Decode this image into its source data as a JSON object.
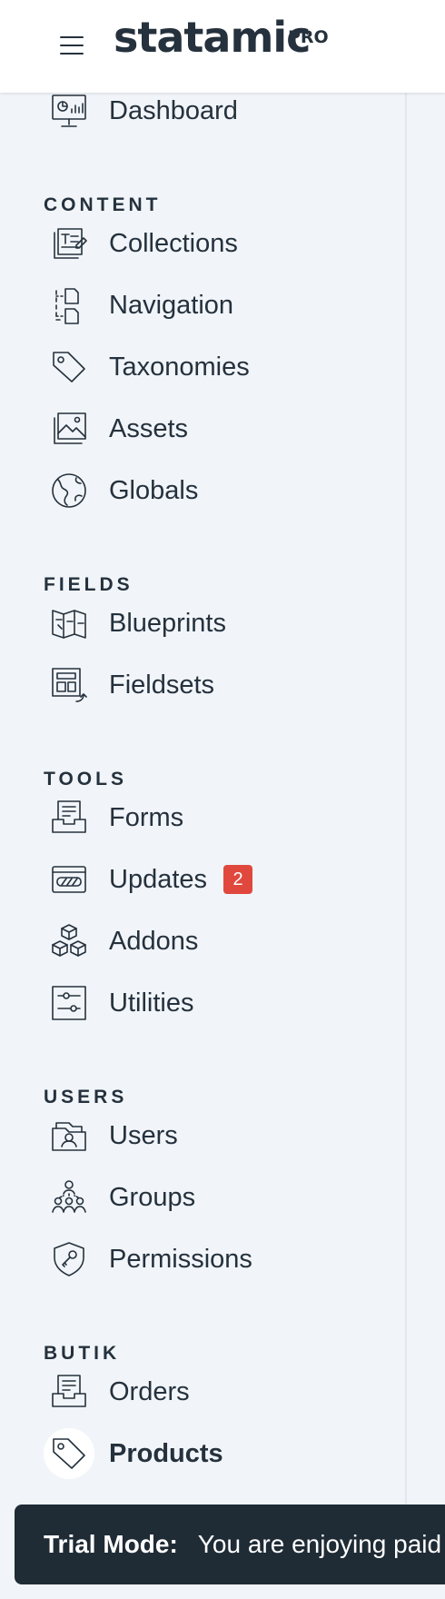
{
  "header": {
    "logo": "statamic",
    "edition": "PRO"
  },
  "nav": {
    "dashboard": {
      "label": "Dashboard",
      "icon": "dashboard-icon"
    },
    "sections": [
      {
        "title": "CONTENT",
        "items": [
          {
            "label": "Collections",
            "icon": "collections-icon"
          },
          {
            "label": "Navigation",
            "icon": "navigation-icon"
          },
          {
            "label": "Taxonomies",
            "icon": "taxonomies-icon"
          },
          {
            "label": "Assets",
            "icon": "assets-icon"
          },
          {
            "label": "Globals",
            "icon": "globals-icon"
          }
        ]
      },
      {
        "title": "FIELDS",
        "items": [
          {
            "label": "Blueprints",
            "icon": "blueprints-icon"
          },
          {
            "label": "Fieldsets",
            "icon": "fieldsets-icon"
          }
        ]
      },
      {
        "title": "TOOLS",
        "items": [
          {
            "label": "Forms",
            "icon": "forms-icon"
          },
          {
            "label": "Updates",
            "icon": "updates-icon",
            "badge": "2"
          },
          {
            "label": "Addons",
            "icon": "addons-icon"
          },
          {
            "label": "Utilities",
            "icon": "utilities-icon"
          }
        ]
      },
      {
        "title": "USERS",
        "items": [
          {
            "label": "Users",
            "icon": "users-icon"
          },
          {
            "label": "Groups",
            "icon": "groups-icon"
          },
          {
            "label": "Permissions",
            "icon": "permissions-icon"
          }
        ]
      },
      {
        "title": "BUTIK",
        "items": [
          {
            "label": "Orders",
            "icon": "orders-icon"
          },
          {
            "label": "Products",
            "icon": "products-icon",
            "active": true
          }
        ]
      }
    ]
  },
  "trial": {
    "label": "Trial Mode:",
    "message": "You are enjoying paid"
  },
  "colors": {
    "background": "#f1f5f9",
    "text": "#25313d",
    "badge": "#e0483e",
    "trial_bar": "#1f2b35"
  }
}
